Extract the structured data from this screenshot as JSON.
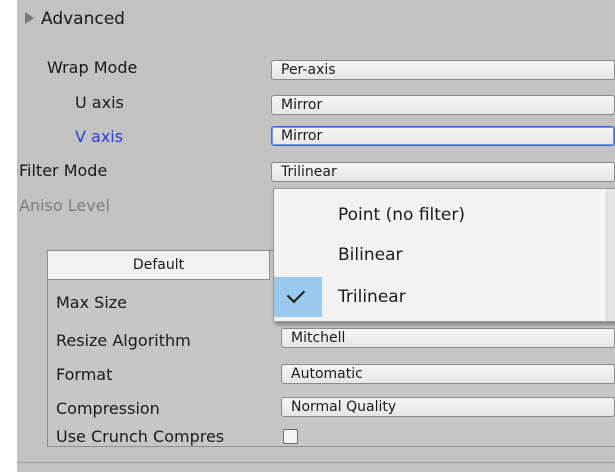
{
  "section": {
    "title": "Advanced"
  },
  "settings": {
    "wrap_mode": {
      "label": "Wrap Mode",
      "value": "Per-axis"
    },
    "u_axis": {
      "label": "U axis",
      "value": "Mirror"
    },
    "v_axis": {
      "label": "V axis",
      "value": "Mirror"
    },
    "filter_mode": {
      "label": "Filter Mode",
      "value": "Trilinear"
    },
    "aniso_level": {
      "label": "Aniso Level"
    }
  },
  "dropdown": {
    "options": [
      "Point (no filter)",
      "Bilinear",
      "Trilinear"
    ],
    "selected": "Trilinear"
  },
  "platform": {
    "tab_default": "Default",
    "max_size": {
      "label": "Max Size"
    },
    "resize_algorithm": {
      "label": "Resize Algorithm",
      "value": "Mitchell"
    },
    "format": {
      "label": "Format",
      "value": "Automatic"
    },
    "compression": {
      "label": "Compression",
      "value": "Normal Quality"
    },
    "crunch": {
      "label": "Use Crunch Compres",
      "checked": false
    }
  },
  "colors": {
    "panel": "#c2c2c2",
    "highlight_label": "#2a3cd6",
    "selected_item": "#99c9ef"
  },
  "icons": [
    "foldout-arrow-icon",
    "checkmark-icon",
    "checkbox-icon"
  ]
}
